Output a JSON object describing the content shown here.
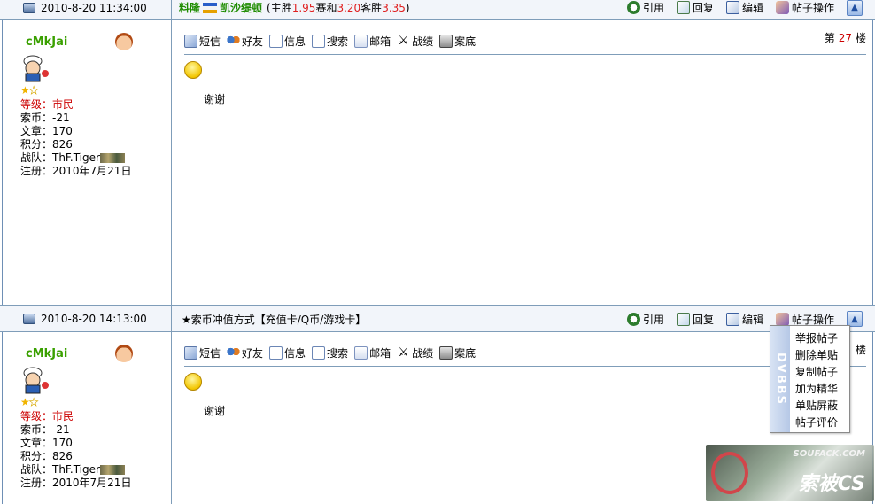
{
  "posts": [
    {
      "header": {
        "time": "2010-8-20 11:34:00",
        "title_prefix": "料隆",
        "title_team": "凯沙缇顿",
        "title_rest_a": "(主胜",
        "odd_home": "1.95",
        "title_rest_b": " 赛和",
        "odd_draw": "3.20",
        "title_rest_c": " 客胜",
        "odd_away": "3.35",
        "title_rest_d": ")"
      },
      "user": {
        "name": "cMkJai",
        "level_label": "等级：",
        "level_value": "市民",
        "coins": "索币：-21",
        "articles": "文章：170",
        "points": "积分：826",
        "team_label": "战队：ThF.Tiger",
        "registered": "注册：2010年7月21日"
      },
      "floor_prefix": "第",
      "floor_num": "27",
      "floor_suffix": "楼",
      "message": "谢谢"
    },
    {
      "header": {
        "time": "2010-8-20 14:13:00",
        "signature": "★索币冲值方式【充值卡/Q币/游戏卡】"
      },
      "user": {
        "name": "cMkJai",
        "level_label": "等级：",
        "level_value": "市民",
        "coins": "索币：-21",
        "articles": "文章：170",
        "points": "积分：826",
        "team_label": "战队：ThF.Tiger",
        "registered": "注册：2010年7月21日"
      },
      "floor_suffix": "楼",
      "message": "谢谢"
    }
  ],
  "actions": {
    "quote": "引用",
    "reply": "回复",
    "edit": "编辑",
    "ops": "帖子操作"
  },
  "toolbar": {
    "sms": "短信",
    "friend": "好友",
    "info": "信息",
    "search": "搜索",
    "mail": "邮箱",
    "score": "战绩",
    "case": "案底"
  },
  "context_menu": {
    "strip_text": "DVBBS",
    "items": [
      "举报帖子",
      "删除单贴",
      "复制帖子",
      "加为精华",
      "单贴屏蔽",
      "帖子评价"
    ]
  },
  "logo": {
    "site": "SOUFACK.COM",
    "brand": "索被CS"
  },
  "colors": {
    "title_green": "#1e8c00",
    "odds_red": "#e02020",
    "username_green": "#3aa000",
    "border_blue": "#7f9db9"
  }
}
